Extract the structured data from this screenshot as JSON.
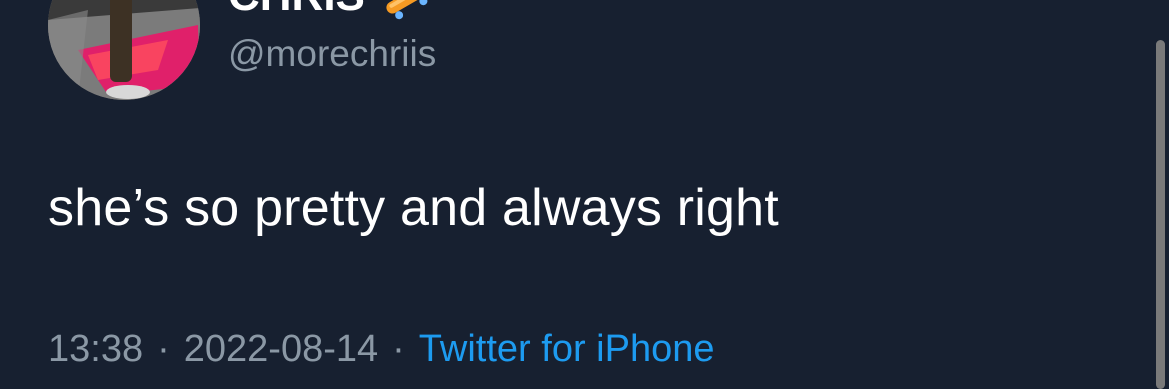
{
  "author": {
    "display_name": "CHRIS",
    "name_emoji": "skateboard-icon",
    "handle": "@morechriis",
    "avatar_icon": "avatar"
  },
  "tweet": {
    "text": "she’s so pretty and always right"
  },
  "meta": {
    "time": "13:38",
    "separator": "·",
    "date": "2022-08-14",
    "source": "Twitter for iPhone"
  },
  "colors": {
    "background": "#172030",
    "text_primary": "#ffffff",
    "text_secondary": "#8b98a5",
    "link": "#1d9bf0"
  }
}
